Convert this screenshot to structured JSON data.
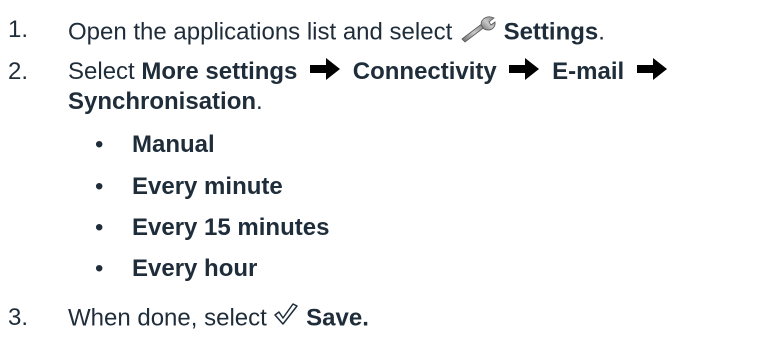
{
  "steps": [
    {
      "number": "1.",
      "text": "Open the applications list and select",
      "icon": "wrench-icon",
      "bold": "Settings",
      "end": "."
    },
    {
      "number": "2.",
      "text": "Select",
      "path": [
        "More settings",
        "Connectivity",
        "E-mail",
        "Synchronisation"
      ],
      "separator_icon": "right-arrow-icon",
      "end": ".",
      "options": [
        "Manual",
        "Every minute",
        "Every 15 minutes",
        "Every hour"
      ],
      "bullet": "•"
    },
    {
      "number": "3.",
      "text": "When done, select",
      "icon": "checkmark-icon",
      "bold": "Save."
    }
  ]
}
